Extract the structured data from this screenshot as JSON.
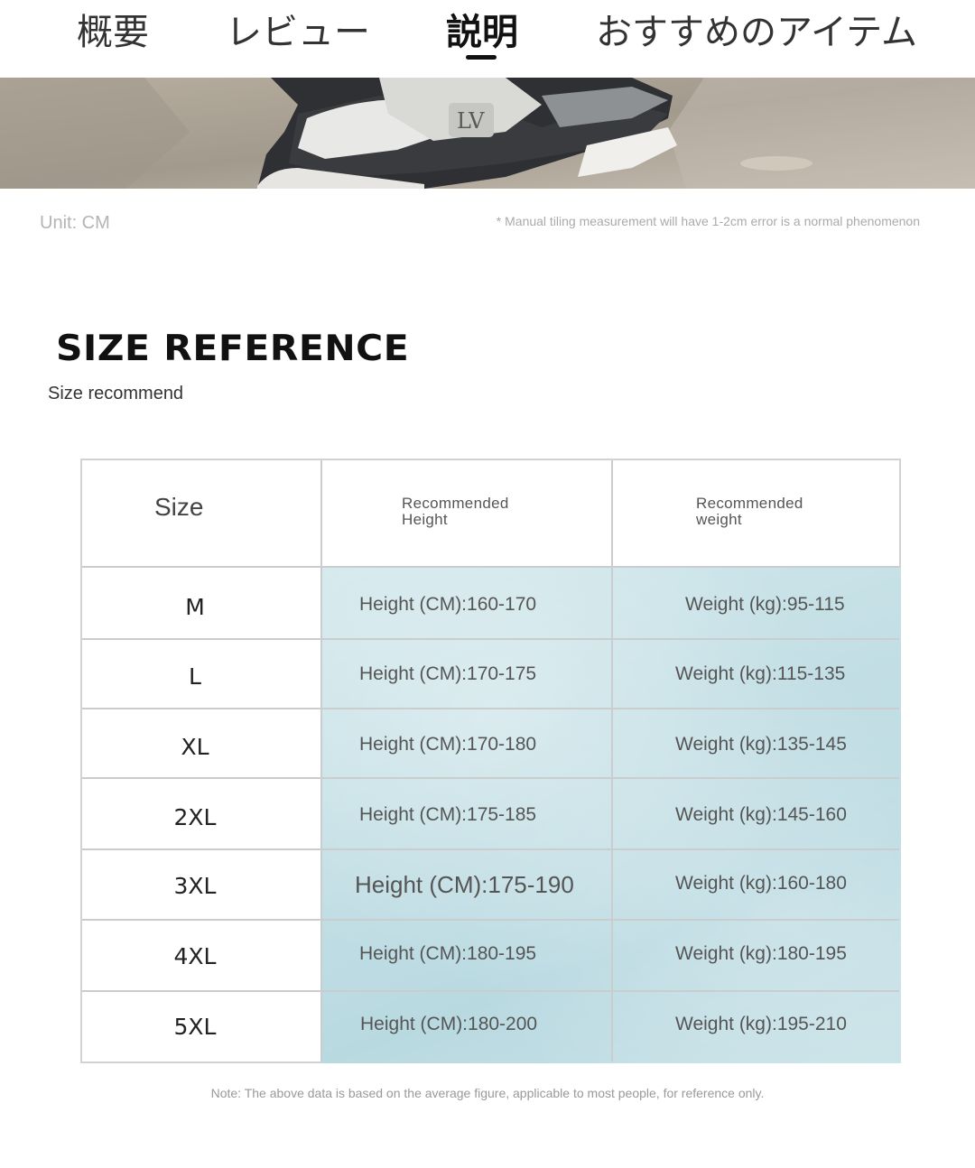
{
  "tabs": [
    {
      "label": "概要",
      "active": false
    },
    {
      "label": "レビュー",
      "active": false
    },
    {
      "label": "説明",
      "active": true
    },
    {
      "label": "おすすめのアイテム",
      "active": false
    }
  ],
  "photo": {
    "icon": "sneaker-photo"
  },
  "unit_label": "Unit: CM",
  "measurement_note": "* Manual tiling measurement will have 1-2cm error is a normal phenomenon",
  "size_reference": {
    "title": "SIZE REFERENCE",
    "subtitle": "Size recommend"
  },
  "table": {
    "headers": {
      "size": "Size",
      "height": "Recommended\nHeight",
      "weight": "Recommended\nweight"
    },
    "rows": [
      {
        "size": "M",
        "height": "Height (CM):160-170",
        "weight": "Weight (kg):95-115"
      },
      {
        "size": "L",
        "height": "Height (CM):170-175",
        "weight": "Weight (kg):115-135"
      },
      {
        "size": "XL",
        "height": "Height (CM):170-180",
        "weight": "Weight (kg):135-145"
      },
      {
        "size": "2XL",
        "height": "Height (CM):175-185",
        "weight": "Weight (kg):145-160"
      },
      {
        "size": "3XL",
        "height": "Height (CM):175-190",
        "weight": "Weight (kg):160-180"
      },
      {
        "size": "4XL",
        "height": "Height (CM):180-195",
        "weight": "Weight (kg):180-195"
      },
      {
        "size": "5XL",
        "height": "Height (CM):180-200",
        "weight": "Weight (kg):195-210"
      }
    ]
  },
  "footnote": "Note: The above data is based on the average figure, applicable to most people, for reference only.",
  "colors": {
    "tab_indicator": "#111111",
    "table_tint": "#c3dfe5",
    "grid_line": "#c9cdce"
  }
}
